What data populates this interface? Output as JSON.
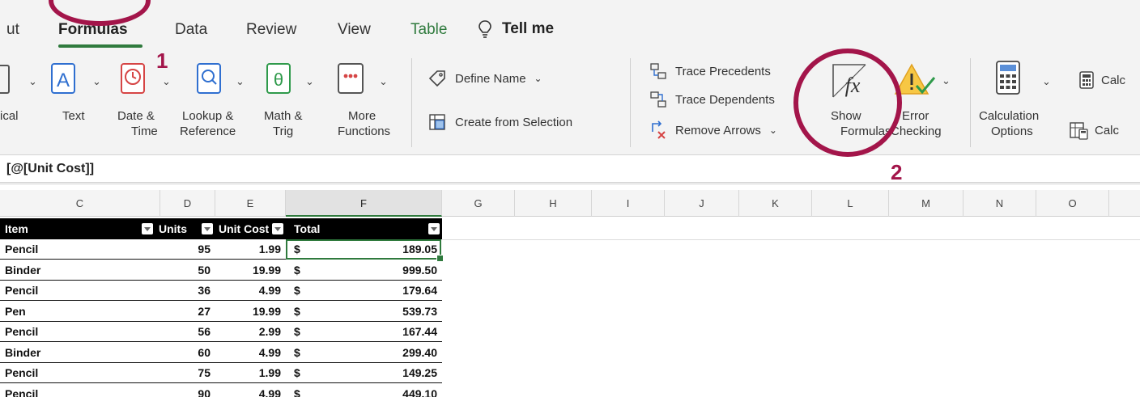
{
  "tabs": [
    {
      "label": "ut",
      "active": false
    },
    {
      "label": "Formulas",
      "active": true
    },
    {
      "label": "Data",
      "active": false
    },
    {
      "label": "Review",
      "active": false
    },
    {
      "label": "View",
      "active": false
    },
    {
      "label": "Table",
      "active": false
    }
  ],
  "tell_me": {
    "label": "Tell me",
    "icon": "lightbulb-icon"
  },
  "ribbon": {
    "logical": {
      "label": "ical"
    },
    "text": {
      "label": "Text",
      "color": "#2f6fd0"
    },
    "date_time": {
      "label_line1": "Date &",
      "label_line2": "Time",
      "color": "#d64545"
    },
    "lookup": {
      "label_line1": "Lookup &",
      "label_line2": "Reference",
      "color": "#2f6fd0"
    },
    "math": {
      "label_line1": "Math &",
      "label_line2": "Trig",
      "glyph": "θ",
      "color": "#2f9a4b"
    },
    "more": {
      "label_line1": "More",
      "label_line2": "Functions",
      "glyph": "···",
      "color": "#d64545"
    },
    "define_name": {
      "label": "Define Name"
    },
    "create_from_selection": {
      "label": "Create from Selection"
    },
    "trace_precedents": {
      "label": "Trace Precedents"
    },
    "trace_dependents": {
      "label": "Trace Dependents"
    },
    "remove_arrows": {
      "label": "Remove Arrows"
    },
    "show_formulas": {
      "label_line1": "Show",
      "label_line2": "Formulas",
      "glyph": "fx"
    },
    "error_checking": {
      "label_line1": "Error",
      "label_line2": "Checking"
    },
    "calc_options": {
      "label_line1": "Calculation",
      "label_line2": "Options"
    },
    "calc_now": {
      "label": "Calc"
    },
    "calc_sheet": {
      "label": "Calc"
    }
  },
  "formula_bar": {
    "text": "[@[Unit Cost]]"
  },
  "columns": [
    "C",
    "D",
    "E",
    "F",
    "G",
    "H",
    "I",
    "J",
    "K",
    "L",
    "M",
    "N",
    "O"
  ],
  "table": {
    "headers": [
      "Item",
      "Units",
      "Unit Cost",
      "Total"
    ],
    "rows": [
      {
        "item": "Pencil",
        "units": "95",
        "cost": "1.99",
        "cur": "$",
        "total": "189.05"
      },
      {
        "item": "Binder",
        "units": "50",
        "cost": "19.99",
        "cur": "$",
        "total": "999.50"
      },
      {
        "item": "Pencil",
        "units": "36",
        "cost": "4.99",
        "cur": "$",
        "total": "179.64"
      },
      {
        "item": "Pen",
        "units": "27",
        "cost": "19.99",
        "cur": "$",
        "total": "539.73"
      },
      {
        "item": "Pencil",
        "units": "56",
        "cost": "2.99",
        "cur": "$",
        "total": "167.44"
      },
      {
        "item": "Binder",
        "units": "60",
        "cost": "4.99",
        "cur": "$",
        "total": "299.40"
      },
      {
        "item": "Pencil",
        "units": "75",
        "cost": "1.99",
        "cur": "$",
        "total": "149.25"
      },
      {
        "item": "Pencil",
        "units": "90",
        "cost": "4.99",
        "cur": "$",
        "total": "449.10"
      }
    ]
  },
  "annotations": {
    "step1": "1",
    "step2": "2",
    "color": "#a3154a"
  }
}
